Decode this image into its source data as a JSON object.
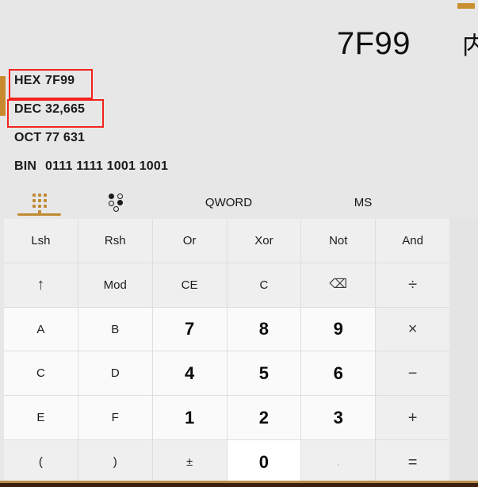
{
  "window": {
    "accent_color": "#c8902f",
    "annotation_color": "#f4221c",
    "background_color": "#e7e7e7"
  },
  "display": {
    "result": "7F99",
    "clipped_label": "内",
    "radix_rows": [
      {
        "name": "hex-row",
        "label": "HEX",
        "value": "7F99",
        "annotated": true
      },
      {
        "name": "dec-row",
        "label": "DEC",
        "value": "32,665",
        "annotated": true
      },
      {
        "name": "oct-row",
        "label": "OCT",
        "value": "77 631",
        "annotated": false
      },
      {
        "name": "bin-row",
        "label": "BIN",
        "value": "0111 1111 1001 1001",
        "annotated": false
      }
    ]
  },
  "tabs": [
    {
      "name": "tab-keypad",
      "label": "",
      "icon": "keypad-grid-icon",
      "selected": true
    },
    {
      "name": "tab-bit-toggle",
      "label": "",
      "icon": "bit-toggle-icon",
      "selected": false
    },
    {
      "name": "tab-word-size",
      "label": "QWORD",
      "icon": "",
      "selected": false
    },
    {
      "name": "tab-memory",
      "label": "MS",
      "icon": "",
      "selected": false
    }
  ],
  "keypad": {
    "rows": [
      [
        {
          "name": "key-lsh",
          "label": "Lsh",
          "kind": "fn"
        },
        {
          "name": "key-rsh",
          "label": "Rsh",
          "kind": "fn"
        },
        {
          "name": "key-or",
          "label": "Or",
          "kind": "fn"
        },
        {
          "name": "key-xor",
          "label": "Xor",
          "kind": "fn"
        },
        {
          "name": "key-not",
          "label": "Not",
          "kind": "fn"
        },
        {
          "name": "key-and",
          "label": "And",
          "kind": "fn"
        }
      ],
      [
        {
          "name": "key-shift-up",
          "label": "↑",
          "kind": "op"
        },
        {
          "name": "key-mod",
          "label": "Mod",
          "kind": "fn"
        },
        {
          "name": "key-clear-entry",
          "label": "CE",
          "kind": "fn"
        },
        {
          "name": "key-clear",
          "label": "C",
          "kind": "fn"
        },
        {
          "name": "key-backspace",
          "label": "⌫",
          "kind": "op"
        },
        {
          "name": "key-divide",
          "label": "÷",
          "kind": "op"
        }
      ],
      [
        {
          "name": "key-hex-a",
          "label": "A",
          "kind": "hexl"
        },
        {
          "name": "key-hex-b",
          "label": "B",
          "kind": "hexl"
        },
        {
          "name": "key-7",
          "label": "7",
          "kind": "num"
        },
        {
          "name": "key-8",
          "label": "8",
          "kind": "num"
        },
        {
          "name": "key-9",
          "label": "9",
          "kind": "num"
        },
        {
          "name": "key-multiply",
          "label": "×",
          "kind": "op"
        }
      ],
      [
        {
          "name": "key-hex-c",
          "label": "C",
          "kind": "hexl"
        },
        {
          "name": "key-hex-d",
          "label": "D",
          "kind": "hexl"
        },
        {
          "name": "key-4",
          "label": "4",
          "kind": "num"
        },
        {
          "name": "key-5",
          "label": "5",
          "kind": "num"
        },
        {
          "name": "key-6",
          "label": "6",
          "kind": "num"
        },
        {
          "name": "key-subtract",
          "label": "−",
          "kind": "op"
        }
      ],
      [
        {
          "name": "key-hex-e",
          "label": "E",
          "kind": "hexl"
        },
        {
          "name": "key-hex-f",
          "label": "F",
          "kind": "hexl"
        },
        {
          "name": "key-1",
          "label": "1",
          "kind": "num"
        },
        {
          "name": "key-2",
          "label": "2",
          "kind": "num"
        },
        {
          "name": "key-3",
          "label": "3",
          "kind": "num"
        },
        {
          "name": "key-add",
          "label": "+",
          "kind": "op"
        }
      ],
      [
        {
          "name": "key-paren-open",
          "label": "(",
          "kind": "fn"
        },
        {
          "name": "key-paren-close",
          "label": ")",
          "kind": "fn"
        },
        {
          "name": "key-plus-minus",
          "label": "±",
          "kind": "fn"
        },
        {
          "name": "key-0",
          "label": "0",
          "kind": "num",
          "hover": true
        },
        {
          "name": "key-decimal",
          "label": ".",
          "kind": "fn",
          "disabled": true
        },
        {
          "name": "key-equals",
          "label": "=",
          "kind": "op"
        }
      ]
    ]
  }
}
